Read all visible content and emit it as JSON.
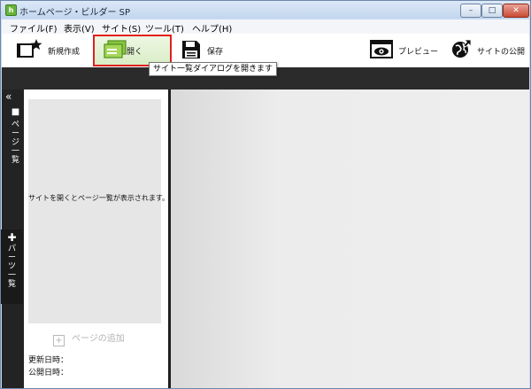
{
  "window": {
    "title": "ホームページ・ビルダー SP",
    "app_icon_letter": "h",
    "buttons": {
      "minimize": "–",
      "maximize": "□",
      "close": "✕"
    }
  },
  "menubar": [
    {
      "label": "ファイル(F)"
    },
    {
      "label": "表示(V)"
    },
    {
      "label": "サイト(S)"
    },
    {
      "label": "ツール(T)"
    },
    {
      "label": "ヘルプ(H)"
    }
  ],
  "toolbar": {
    "new_label": "新規作成",
    "open_label": "開く",
    "save_label": "保存",
    "preview_label": "プレビュー",
    "publish_label": "サイトの公開",
    "open_tooltip": "サイト一覧ダイアログを開きます",
    "accent_open": "#e01f1f"
  },
  "sidebar": {
    "collapse_glyph": "«",
    "tab_pages": [
      "ペ",
      "ー",
      "ジ",
      "一",
      "覧"
    ],
    "tab_parts": [
      "パ",
      "ー",
      "ツ",
      "一",
      "覧"
    ],
    "tab_pages_icon": "■",
    "tab_parts_icon": "✚"
  },
  "page_panel": {
    "empty_message": "サイトを開くとページ一覧が表示されます。",
    "add_page_label": "ページの追加",
    "updated_label": "更新日時：",
    "published_label": "公開日時："
  }
}
